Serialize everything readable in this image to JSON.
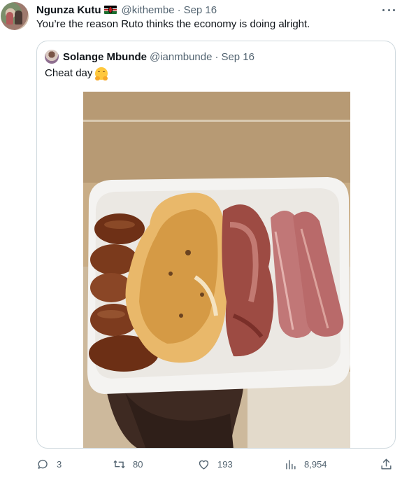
{
  "tweet": {
    "author_name": "Ngunza Kutu",
    "author_flag": "kenya-flag-icon",
    "handle": "@kithembe",
    "separator": "·",
    "date": "Sep 16",
    "text": "You’re the reason Ruto thinks the economy is doing alright."
  },
  "quoted": {
    "author_name": "Solange Mbunde",
    "handle": "@ianmbunde",
    "separator": "·",
    "date": "Sep 16",
    "text": "Cheat day",
    "emoji": "hugging-face-emoji",
    "image": "breakfast-plate-photo"
  },
  "actions": {
    "replies": "3",
    "retweets": "80",
    "likes": "193",
    "views": "8,954"
  },
  "colors": {
    "text_primary": "#0f1419",
    "text_secondary": "#536471",
    "border": "#cfd9de"
  }
}
